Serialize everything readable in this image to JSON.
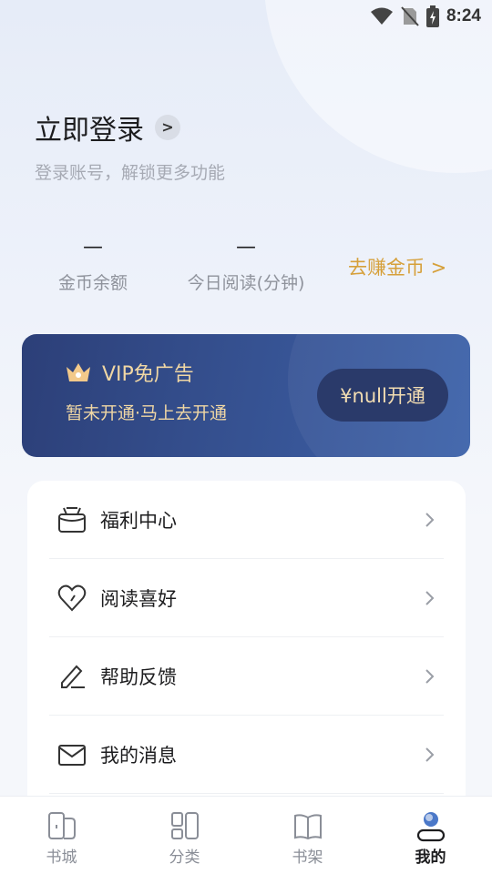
{
  "status_bar": {
    "time": "8:24",
    "icons": [
      "wifi-icon",
      "no-sim-icon",
      "battery-charging-icon"
    ]
  },
  "profile": {
    "login_title": "立即登录",
    "login_chevron": ">",
    "login_subtitle": "登录账号，解锁更多功能"
  },
  "stats": {
    "coins": {
      "value": "—",
      "label": "金币余额"
    },
    "reading": {
      "value": "—",
      "label": "今日阅读(分钟)"
    },
    "earn_link": "去赚金币 >"
  },
  "vip": {
    "title": "VIP免广告",
    "subtitle": "暂未开通·马上去开通",
    "button": "¥null开通",
    "icon": "crown-icon",
    "colors": {
      "text": "#f0d7a4",
      "bg": "#35508f",
      "button_bg": "#1f3063"
    }
  },
  "menu": [
    {
      "label": "福利中心",
      "icon": "gift-icon"
    },
    {
      "label": "阅读喜好",
      "icon": "heart-icon"
    },
    {
      "label": "帮助反馈",
      "icon": "edit-icon"
    },
    {
      "label": "我的消息",
      "icon": "mail-icon"
    }
  ],
  "bottom_nav": [
    {
      "label": "书城",
      "icon": "bookstore-icon",
      "active": false
    },
    {
      "label": "分类",
      "icon": "category-icon",
      "active": false
    },
    {
      "label": "书架",
      "icon": "bookshelf-icon",
      "active": false
    },
    {
      "label": "我的",
      "icon": "profile-icon",
      "active": true
    }
  ],
  "colors": {
    "accent_gold": "#d6a03a",
    "text_dark": "#1d1d1f",
    "text_muted": "#8f939c"
  }
}
